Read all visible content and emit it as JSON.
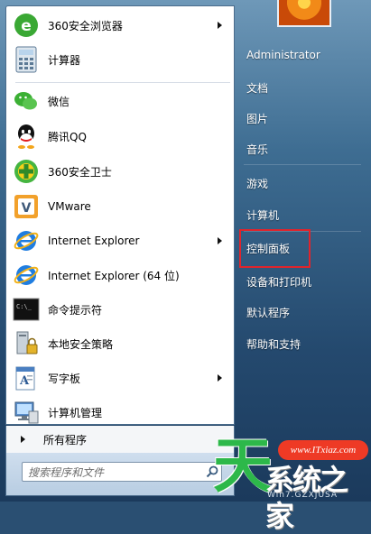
{
  "left_items": [
    {
      "label": "360安全浏览器",
      "icon": "360-browser-icon",
      "arrow": true
    },
    {
      "label": "计算器",
      "icon": "calculator-icon",
      "arrow": false
    },
    {
      "label": "微信",
      "icon": "wechat-icon",
      "arrow": false
    },
    {
      "label": "腾讯QQ",
      "icon": "qq-icon",
      "arrow": false
    },
    {
      "label": "360安全卫士",
      "icon": "360-safeguard-icon",
      "arrow": false
    },
    {
      "label": "VMware",
      "icon": "vmware-icon",
      "arrow": false
    },
    {
      "label": "Internet Explorer",
      "icon": "ie-icon",
      "arrow": true
    },
    {
      "label": "Internet Explorer (64 位)",
      "icon": "ie-icon",
      "arrow": false
    },
    {
      "label": "命令提示符",
      "icon": "cmd-icon",
      "arrow": false
    },
    {
      "label": "本地安全策略",
      "icon": "security-policy-icon",
      "arrow": false
    },
    {
      "label": "写字板",
      "icon": "wordpad-icon",
      "arrow": true
    },
    {
      "label": "计算机管理",
      "icon": "computer-management-icon",
      "arrow": false
    }
  ],
  "all_programs": "所有程序",
  "search": {
    "placeholder": "搜索程序和文件"
  },
  "right_items": [
    {
      "label": "Administrator"
    },
    {
      "label": "文档"
    },
    {
      "label": "图片"
    },
    {
      "label": "音乐"
    },
    {
      "label": "游戏"
    },
    {
      "label": "计算机"
    },
    {
      "label": "控制面板"
    },
    {
      "label": "设备和打印机"
    },
    {
      "label": "默认程序"
    },
    {
      "label": "帮助和支持"
    }
  ],
  "highlight_color": "#e0242c",
  "watermark": {
    "logo_char": "天",
    "url": "www.ITxiaz.com",
    "chars": "系统之家",
    "subtitle": "Win7.GZXJUSA"
  }
}
